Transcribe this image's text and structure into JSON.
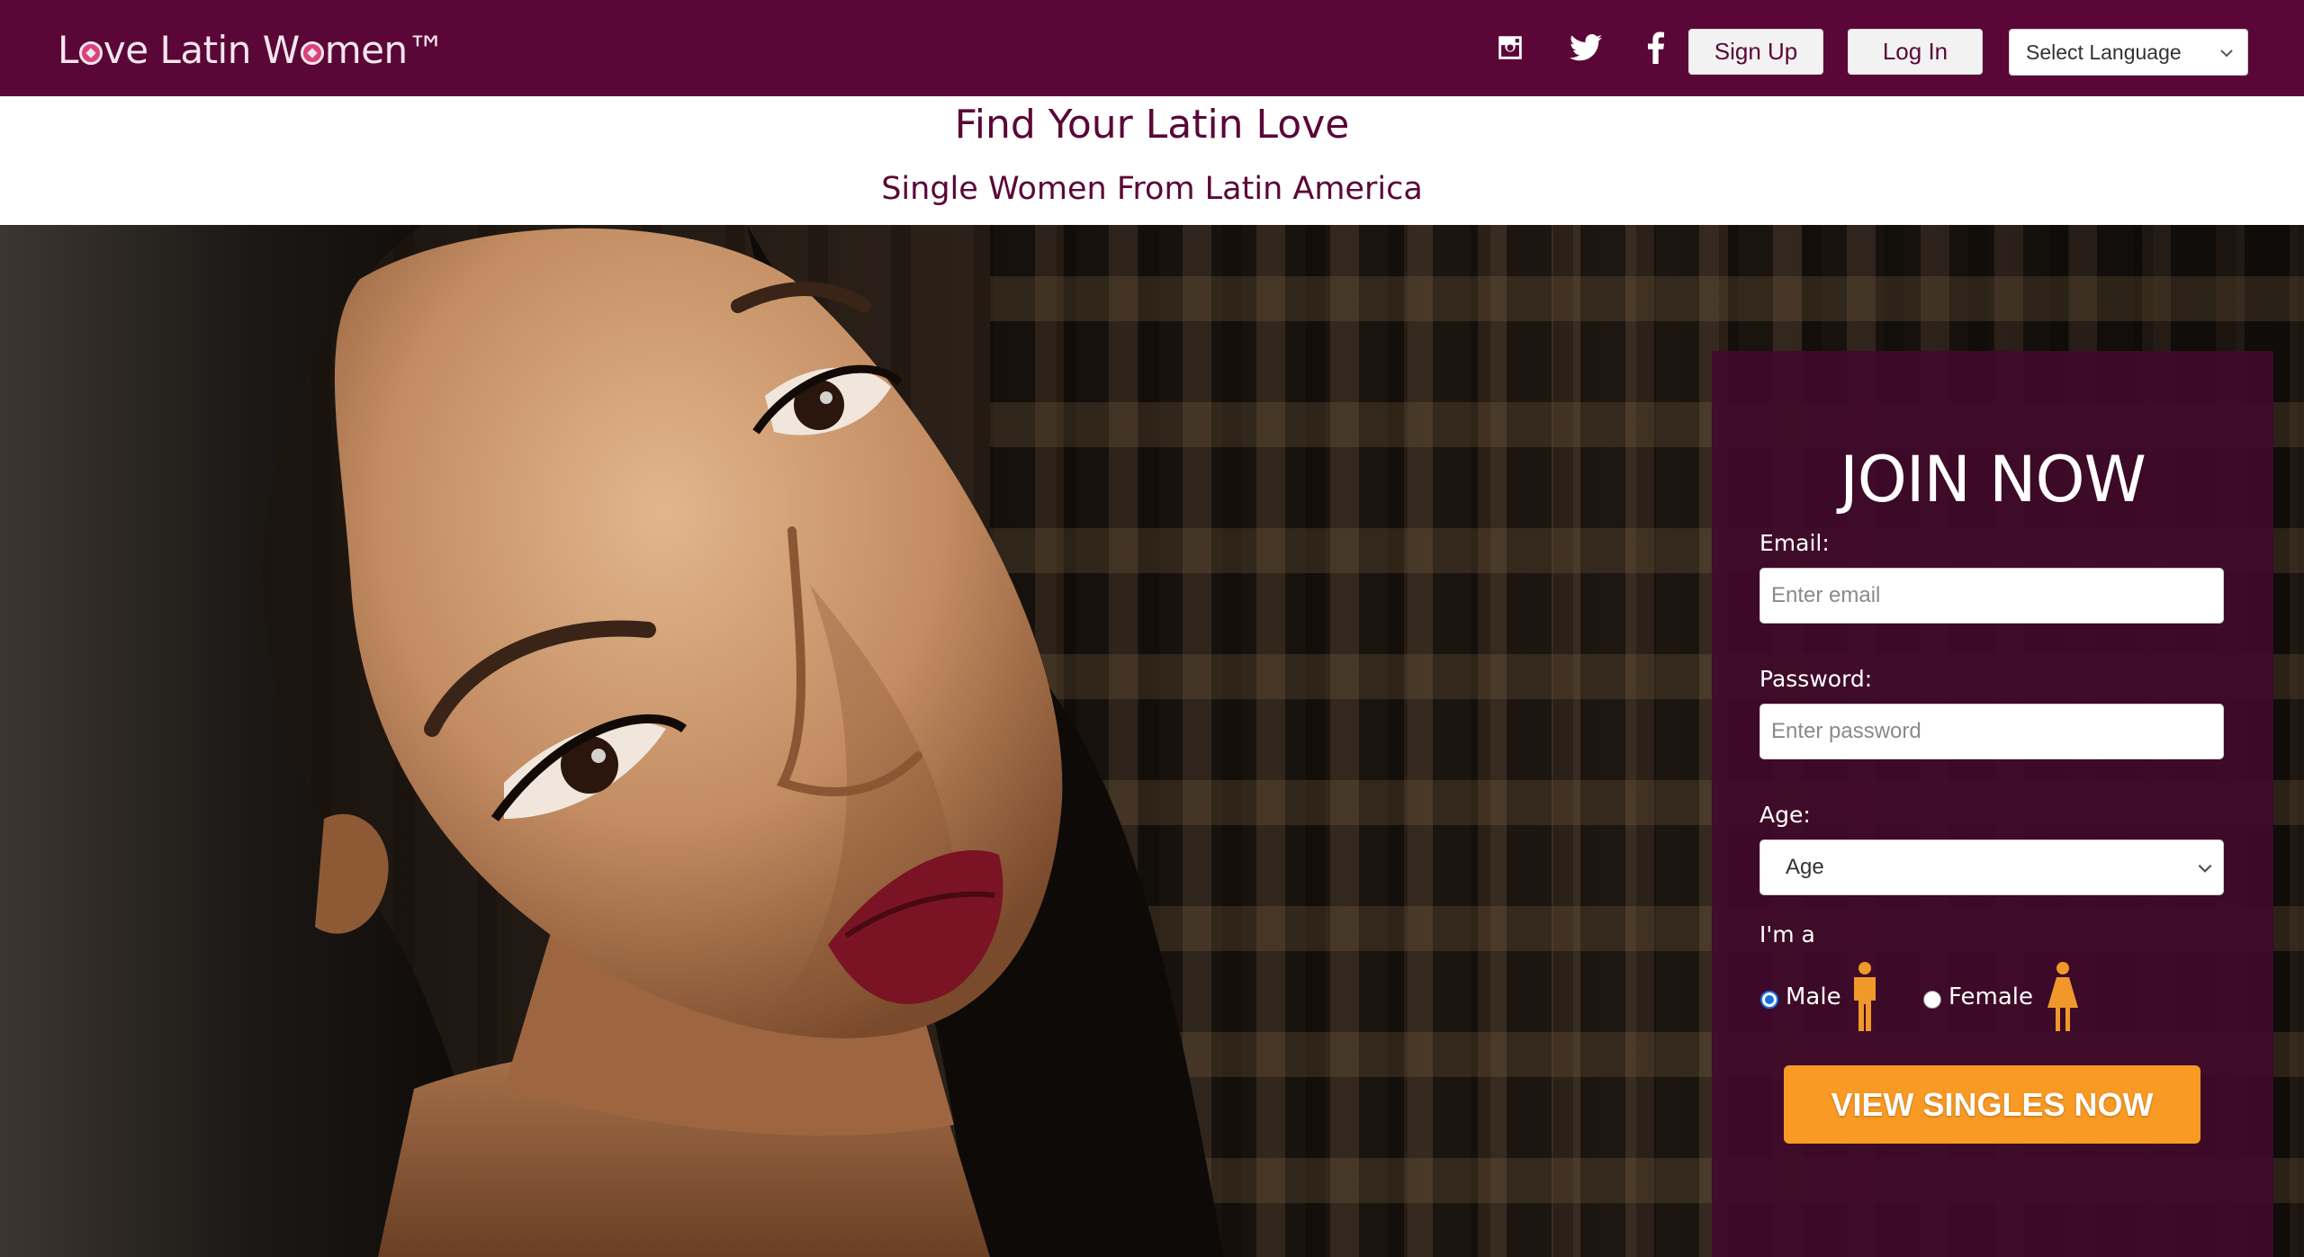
{
  "header": {
    "logo_text_1": "L",
    "logo_text_2": "ve Latin W",
    "logo_text_3": "men™",
    "social": [
      "instagram-icon",
      "twitter-icon",
      "facebook-icon"
    ],
    "signup_label": "Sign Up",
    "login_label": "Log In",
    "language_select": "Select Language"
  },
  "headline": {
    "title": "Find Your Latin Love",
    "subtitle": "Single Women From Latin America"
  },
  "join": {
    "title": "JOIN NOW",
    "email_label": "Email:",
    "email_placeholder": "Enter email",
    "password_label": "Password:",
    "password_placeholder": "Enter password",
    "age_label": "Age:",
    "age_value": "Age",
    "gender_label": "I'm a",
    "male_label": "Male",
    "female_label": "Female",
    "selected_gender": "Male",
    "cta_label": "VIEW SINGLES NOW"
  },
  "colors": {
    "brand": "#5a0737",
    "panel": "#400a2a",
    "cta": "#f89a24",
    "icon_person": "#f0982a"
  }
}
